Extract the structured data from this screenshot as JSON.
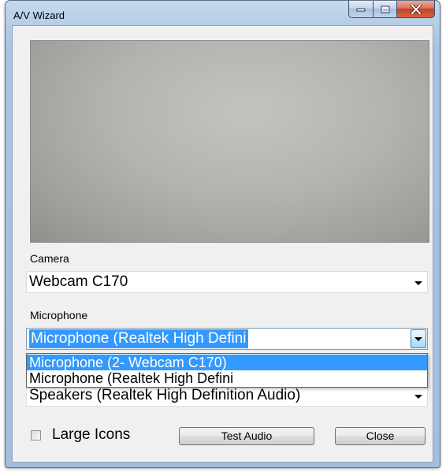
{
  "window": {
    "title": "A/V Wizard",
    "controls": {
      "minimize": "minimize",
      "maximize": "maximize",
      "close": "close"
    }
  },
  "camera": {
    "label": "Camera",
    "selected": "Webcam C170"
  },
  "microphone": {
    "label": "Microphone",
    "selected": "Microphone (Realtek High Defini",
    "options": [
      "Microphone (2- Webcam C170)",
      "Microphone (Realtek High Defini"
    ]
  },
  "speakers": {
    "selected": "Speakers (Realtek High Definition Audio)"
  },
  "footer": {
    "large_icons_label": "Large Icons",
    "large_icons_checked": false,
    "test_audio_label": "Test Audio",
    "close_label": "Close"
  },
  "colors": {
    "selection": "#3399ff",
    "close_button": "#c4422a"
  }
}
